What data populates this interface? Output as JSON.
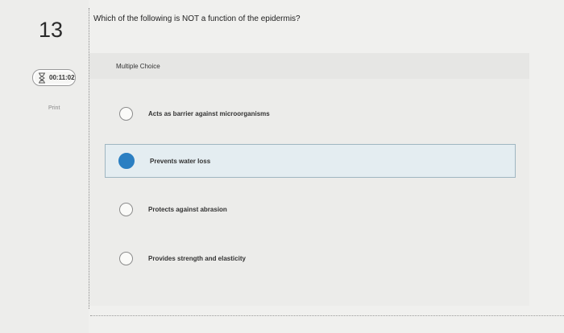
{
  "question": {
    "number": "13",
    "prompt": "Which of the following is NOT a function of the epidermis?",
    "type_label": "Multiple Choice"
  },
  "timer": {
    "value": "00:11:02",
    "icon": "hourglass-icon"
  },
  "print_label": "Print",
  "options": [
    {
      "label": "Acts as barrier against microorganisms",
      "selected": false
    },
    {
      "label": "Prevents water loss",
      "selected": true
    },
    {
      "label": "Protects against abrasion",
      "selected": false
    },
    {
      "label": "Provides strength and elasticity",
      "selected": false
    }
  ],
  "colors": {
    "selected_radio": "#2b7fc2",
    "selected_bg": "#e4edf1"
  }
}
